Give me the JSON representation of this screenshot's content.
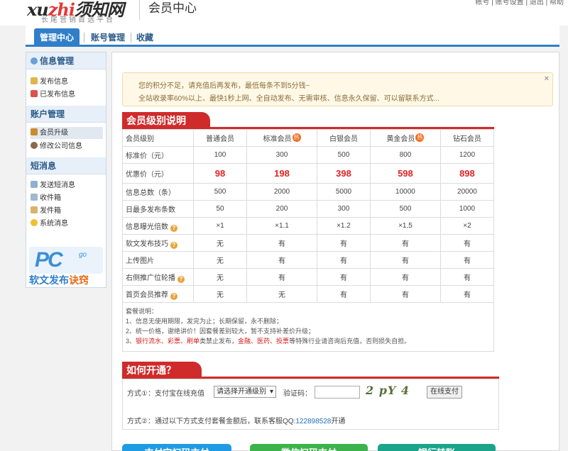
{
  "header": {
    "logo_left": "xu",
    "logo_accent": "zhi",
    "logo_right": "须知网",
    "logo_sub": "长尾营销首选平台",
    "title": "会员中心",
    "top_links": "帐号  | 账号设置 | 退出 | 帮助"
  },
  "nav": {
    "tabs": [
      {
        "label": "管理中心"
      },
      {
        "label": "账号管理"
      },
      {
        "label": "收藏"
      }
    ]
  },
  "sidebar": {
    "sections": [
      {
        "title": "信息管理",
        "items": [
          "发布信息",
          "已发布信息"
        ]
      },
      {
        "title": "账户管理",
        "items": [
          "会员升级",
          "修改公司信息"
        ]
      },
      {
        "title": "短消息",
        "items": [
          "发送短消息",
          "收件箱",
          "发件箱",
          "系统消息"
        ]
      }
    ],
    "promo_logo": "PC",
    "promo_go": "go",
    "promo_text_a": "软文发布",
    "promo_text_b": "诀窍"
  },
  "notice": {
    "line1": "您的积分不足，请充值后再发布，最低每条不到5分钱~",
    "line2": "全站收录率60%以上、最快1秒上网、全自动发布、无需审核、信息永久保留、可以留联系方式...",
    "close": "×"
  },
  "levels": {
    "title": "会员级别说明",
    "header": [
      "会员级别",
      "普通会员",
      "标准会员",
      "白银会员",
      "黄金会员",
      "钻石会员"
    ],
    "hot_label": "热",
    "rows": [
      {
        "label": "标准价（元）",
        "values": [
          "100",
          "300",
          "500",
          "800",
          "1200"
        ]
      },
      {
        "label": "优惠价（元）",
        "values": [
          "98",
          "198",
          "398",
          "598",
          "898"
        ]
      },
      {
        "label": "信息总数（条）",
        "values": [
          "500",
          "2000",
          "5000",
          "10000",
          "20000"
        ]
      },
      {
        "label": "日最多发布条数",
        "values": [
          "50",
          "200",
          "300",
          "500",
          "1000"
        ]
      },
      {
        "label": "信息曝光倍数",
        "values": [
          "×1",
          "×1.1",
          "×1.2",
          "×1.5",
          "×2"
        ]
      },
      {
        "label": "软文发布技巧",
        "values": [
          "无",
          "有",
          "有",
          "有",
          "有"
        ]
      },
      {
        "label": "上传图片",
        "values": [
          "无",
          "有",
          "有",
          "有",
          "有"
        ]
      },
      {
        "label": "右侧推广位轮播",
        "values": [
          "无",
          "有",
          "有",
          "有",
          "有"
        ]
      },
      {
        "label": "首页会员推荐",
        "values": [
          "无",
          "无",
          "有",
          "有",
          "有"
        ]
      }
    ],
    "notes_title": "套餐说明：",
    "note1": "1、信息无使用期限，发完为止；长期保留，永不删除；",
    "note2": "2、统一价格，谢绝讲价！因套餐差别较大，暂不支持补差价升级；",
    "note3_prefix": "3、",
    "note3_red1": "银行流水、彩票、刷单",
    "note3_mid": "类禁止发布，",
    "note3_red2": "金融、医药、投票",
    "note3_suffix": "等特殊行业请咨询后充值，否则损失自担。"
  },
  "howto": {
    "title": "如何开通？",
    "method1_label": "方式①：支付宝在线充值",
    "select_value": "请选择开通级别",
    "vcode_label": "验证码：",
    "captcha_text": "2 pY 4",
    "pay_button": "在线支付",
    "method2_prefix": "方式②：通过以下方式支付套餐金额后，联系客服QQ:",
    "qq": "122898528",
    "method2_suffix": "开通"
  },
  "bottom_buttons": [
    {
      "label": "支付宝扫码支付",
      "color": "#1e9be3"
    },
    {
      "label": "微信扫码支付",
      "color": "#3bb34a"
    },
    {
      "label": "银行转账",
      "color": "#1aa58a"
    }
  ]
}
